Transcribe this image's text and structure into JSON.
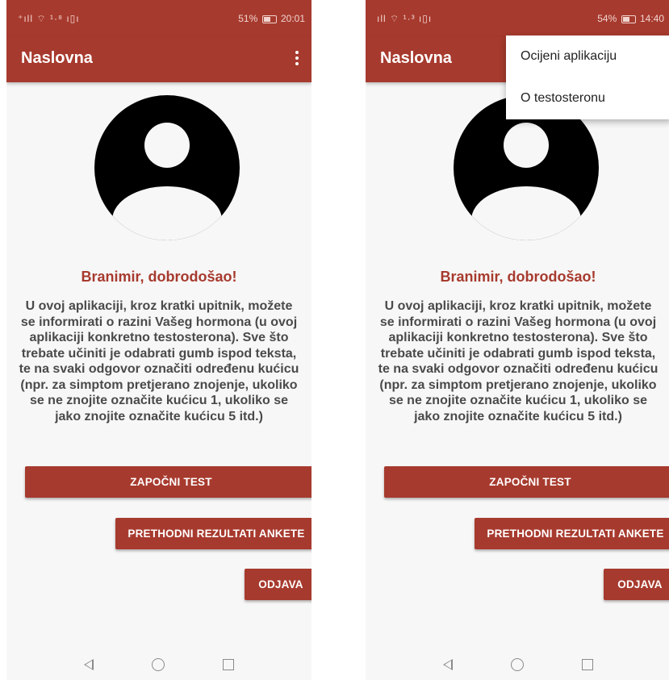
{
  "screens": [
    {
      "status": {
        "signal": "⁺ıll ⌔ ¹·⁸ ı▯ı",
        "battery": "51%",
        "time": "20:01"
      },
      "app_bar": {
        "title": "Naslovna"
      },
      "greeting": "Branimir, dobrodošao!",
      "intro": "U ovoj aplikaciji, kroz kratki upitnik, možete se informirati o razini Vašeg hormona (u ovoj aplikaciji konkretno testosterona). Sve što trebate učiniti je odabrati gumb ispod teksta, te na svaki odgovor označiti određenu kućicu (npr. za simptom pretjerano znojenje, ukoliko se ne znojite označite kućicu 1, ukoliko se jako znojite označite kućicu 5 itd.)",
      "buttons": {
        "start": "ZAPOČNI TEST",
        "previous": "PRETHODNI REZULTATI ANKETE",
        "logout": "ODJAVA"
      }
    },
    {
      "status": {
        "signal": "ıll ⌔ ¹·³ ı▯ı",
        "battery": "54%",
        "time": "14:40"
      },
      "app_bar": {
        "title": "Naslovna"
      },
      "greeting": "Branimir, dobrodošao!",
      "intro": "U ovoj aplikaciji, kroz kratki upitnik, možete se informirati o razini Vašeg hormona (u ovoj aplikaciji konkretno testosterona). Sve što trebate učiniti je odabrati gumb ispod teksta, te na svaki odgovor označiti određenu kućicu (npr. za simptom pretjerano znojenje, ukoliko se ne znojite označite kućicu 1, ukoliko se jako znojite označite kućicu 5 itd.)",
      "buttons": {
        "start": "ZAPOČNI TEST",
        "previous": "PRETHODNI REZULTATI ANKETE",
        "logout": "ODJAVA"
      },
      "menu": [
        "Ocijeni aplikaciju",
        "O testosteronu"
      ]
    }
  ],
  "icons": {
    "avatar": "account-circle-icon",
    "overflow": "more-vert-icon",
    "nav": [
      "back-icon",
      "home-icon",
      "recents-icon"
    ]
  },
  "colors": {
    "primary": "#a73a2e",
    "text": "#4a4a4a",
    "background": "#f7f7f7"
  }
}
